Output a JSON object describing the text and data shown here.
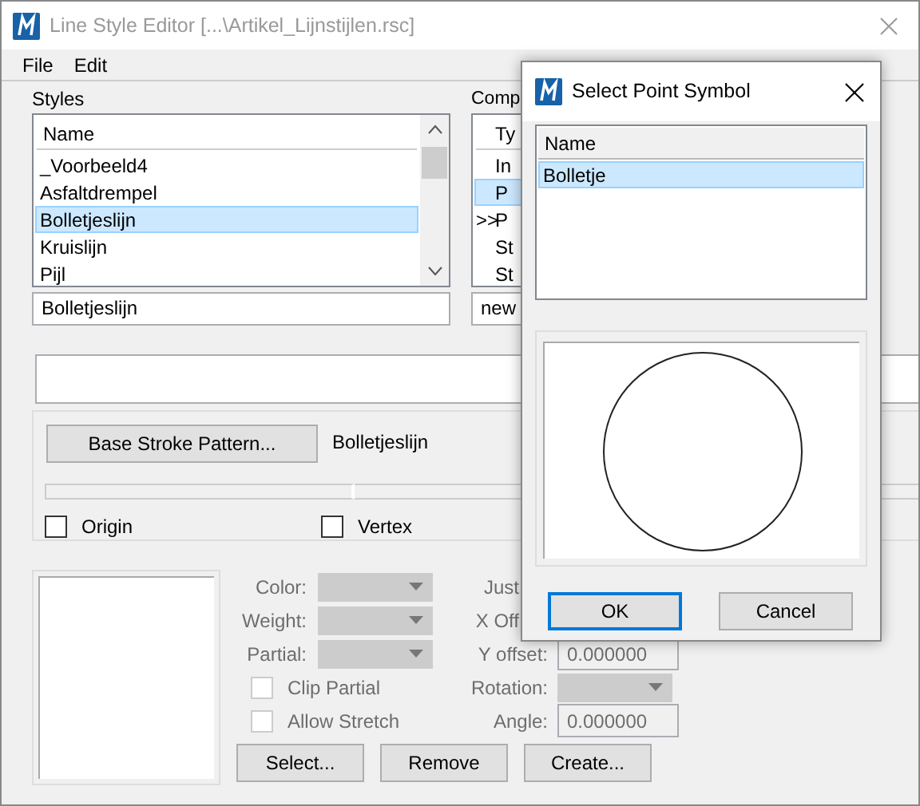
{
  "window": {
    "title": "Line Style Editor [...\\Artikel_Lijnstijlen.rsc]",
    "active": false
  },
  "menu": [
    {
      "label": "File"
    },
    {
      "label": "Edit"
    }
  ],
  "styles": {
    "label": "Styles",
    "column": "Name",
    "rows": [
      {
        "name": "_Voorbeeld4",
        "selected": false
      },
      {
        "name": "Asfaltdrempel",
        "selected": false
      },
      {
        "name": "Bolletjeslijn",
        "selected": true
      },
      {
        "name": "Kruislijn",
        "selected": false
      },
      {
        "name": "Pijl",
        "selected": false
      }
    ],
    "name_value": "Bolletjeslijn"
  },
  "components": {
    "label": "Comp",
    "column": "Ty",
    "rows": [
      {
        "text": "In",
        "selected": false
      },
      {
        "text": "P",
        "selected": true
      },
      {
        "prefix": ">>",
        "text": "P",
        "selected": false
      },
      {
        "text": "St",
        "selected": false
      },
      {
        "text": "St",
        "selected": false
      }
    ],
    "name_value": "new"
  },
  "stroke": {
    "button": "Base Stroke Pattern...",
    "pattern_name": "Bolletjeslijn",
    "checkboxes": [
      {
        "label": "Origin",
        "checked": false
      },
      {
        "label": "Vertex",
        "checked": false
      }
    ]
  },
  "symbol": {
    "left_fields": [
      {
        "label": "Color:",
        "disabled": true
      },
      {
        "label": "Weight:",
        "disabled": true
      },
      {
        "label": "Partial:",
        "disabled": true
      }
    ],
    "checkboxes": [
      {
        "label": "Clip Partial",
        "checked": false,
        "disabled": true
      },
      {
        "label": "Allow Stretch",
        "checked": false,
        "disabled": true
      }
    ],
    "right_fields": [
      {
        "label": "Just",
        "kind": "cut",
        "disabled": true
      },
      {
        "label": "X Off",
        "kind": "cut",
        "disabled": true
      },
      {
        "label": "Y offset:",
        "kind": "text",
        "value": "0.000000",
        "disabled": true
      },
      {
        "label": "Rotation:",
        "kind": "combo",
        "disabled": true
      },
      {
        "label": "Angle:",
        "kind": "text",
        "value": "0.000000",
        "disabled": true
      }
    ],
    "buttons": [
      "Select...",
      "Remove",
      "Create..."
    ]
  },
  "dialog": {
    "title": "Select Point Symbol",
    "column": "Name",
    "rows": [
      {
        "name": "Bolletje",
        "selected": true
      }
    ],
    "buttons": [
      {
        "label": "OK",
        "default": true
      },
      {
        "label": "Cancel",
        "default": false
      }
    ]
  }
}
